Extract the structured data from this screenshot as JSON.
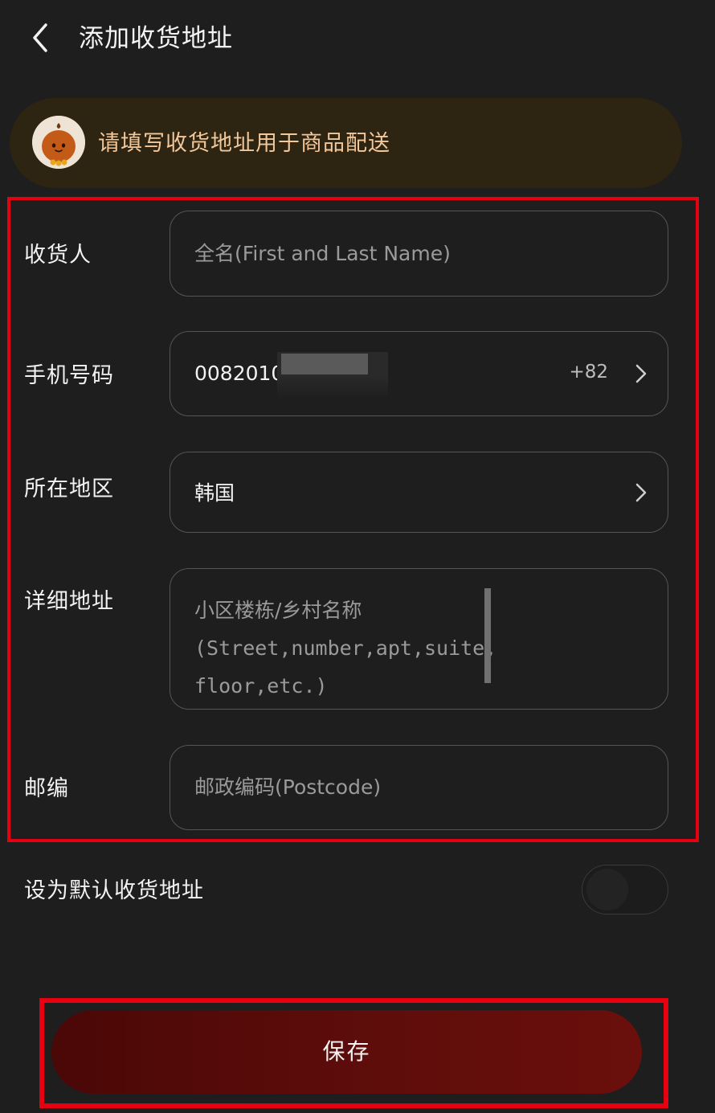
{
  "header": {
    "title": "添加收货地址",
    "back_icon": "chevron-left-icon"
  },
  "notice": {
    "text": "请填写收货地址用于商品配送",
    "mascot_icon": "mascot-avatar-icon"
  },
  "form": {
    "recipient": {
      "label": "收货人",
      "placeholder": "全名(First and Last Name)"
    },
    "phone": {
      "label": "手机号码",
      "value": "0082010",
      "country_code": "+82",
      "chevron_icon": "chevron-right-icon"
    },
    "region": {
      "label": "所在地区",
      "value": "韩国",
      "chevron_icon": "chevron-right-icon"
    },
    "address": {
      "label": "详细地址",
      "placeholder_line1": "小区楼栋/乡村名称",
      "placeholder_line2": "(Street,number,apt,suite,floor,etc.)"
    },
    "postcode": {
      "label": "邮编",
      "placeholder": "邮政编码(Postcode)"
    }
  },
  "default_address": {
    "label": "设为默认收货地址",
    "enabled": false
  },
  "save_button": {
    "label": "保存"
  },
  "colors": {
    "background": "#1e1e1e",
    "accent": "#5e0d0b",
    "highlight_frame": "#e60012",
    "notice_text": "#f2c79a"
  }
}
